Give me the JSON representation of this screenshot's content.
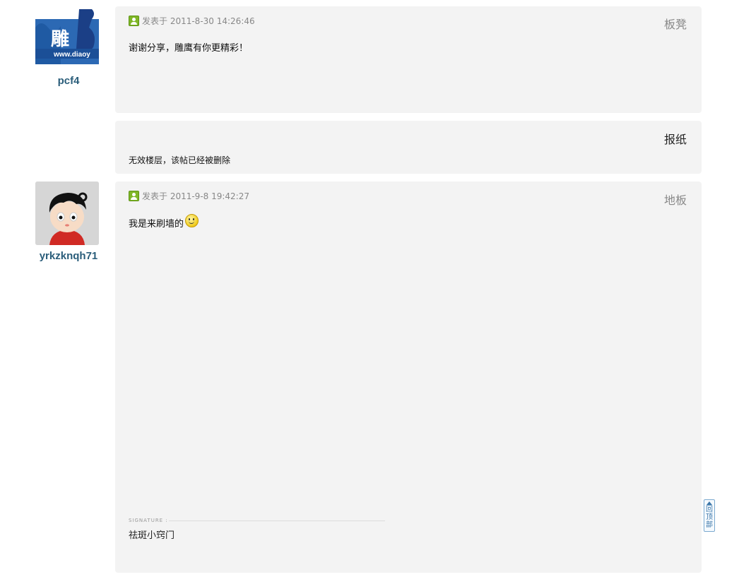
{
  "posts": [
    {
      "username": "pcf4",
      "avatar_text": "雕",
      "avatar_url_text": "www.diaoy",
      "posted": "发表于 2011-8-30 14:26:46",
      "floor": "板凳",
      "content": "谢谢分享，雕鹰有你更精彩！"
    },
    {
      "floor": "报纸",
      "content": "无效楼层，该帖已经被删除"
    },
    {
      "username": "yrkzknqh71",
      "posted": "发表于 2011-9-8 19:42:27",
      "floor": "地板",
      "content": "我是来刷墙的",
      "signature_label": "SIGNATURE :",
      "signature": "祛斑小窍门"
    }
  ],
  "back_to_top": [
    "回",
    "顶",
    "部"
  ],
  "colors": {
    "post_bg": "#f3f3f3",
    "username": "#2a5d7a",
    "accent": "#7fb626"
  }
}
